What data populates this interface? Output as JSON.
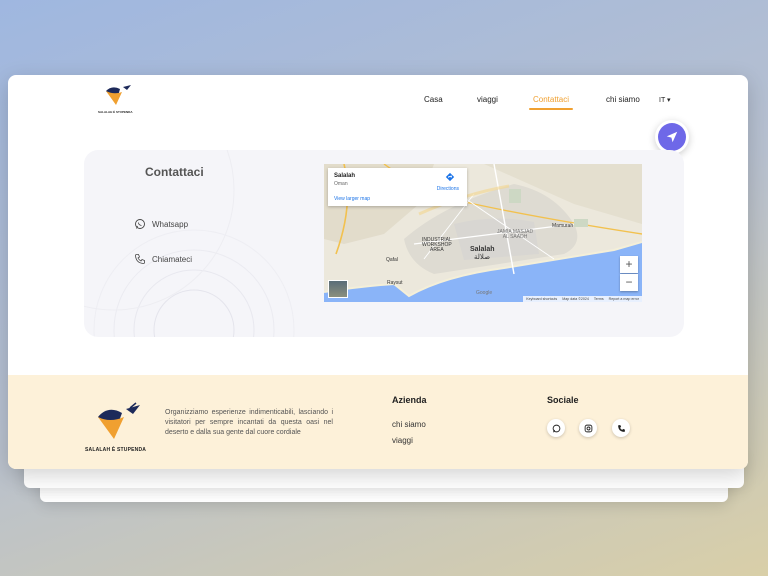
{
  "nav": {
    "items": [
      {
        "label": "Casa",
        "active": false
      },
      {
        "label": "viaggi",
        "active": false
      },
      {
        "label": "Contattaci",
        "active": true
      },
      {
        "label": "chi siamo",
        "active": false
      }
    ],
    "language": "IT ▾"
  },
  "contact": {
    "title": "Contattaci",
    "whatsapp_label": "Whatsapp",
    "call_label": "Chiamateci"
  },
  "map": {
    "place": "Salalah",
    "country": "Oman",
    "directions": "Directions",
    "larger_map": "View larger map",
    "zoom_in": "+",
    "zoom_out": "−",
    "labels": {
      "industrial": "INDUSTRIAL\nWORKSHOP\nAREA",
      "salalah": "Salalah",
      "salalah_ar": "صلالة",
      "jamia": "JAMIA MASJAD\nAL SAADH",
      "mamurah": "Mamurah",
      "qafal": "Qafal",
      "raysut": "Raysut"
    },
    "footer": [
      "Keyboard shortcuts",
      "Map data ©2024",
      "Terms",
      "Report a map error"
    ],
    "google": "Google"
  },
  "footer": {
    "brand": "SALALAH È STUPENDA",
    "blurb": "Organizziamo esperienze indimenticabili, lasciando i visitatori per sempre incantati da questa oasi nel deserto e dalla sua gente dal cuore cordiale",
    "azienda_title": "Azienda",
    "azienda_links": [
      "chi siamo",
      "viaggi"
    ],
    "sociale_title": "Sociale",
    "social_icons": [
      "whatsapp-icon",
      "instagram-icon",
      "phone-icon"
    ]
  },
  "colors": {
    "accent": "#f0a030",
    "brand_navy": "#1d2a5a",
    "send_button": "#6e68e8",
    "footer_bg": "#fdf1d9"
  }
}
